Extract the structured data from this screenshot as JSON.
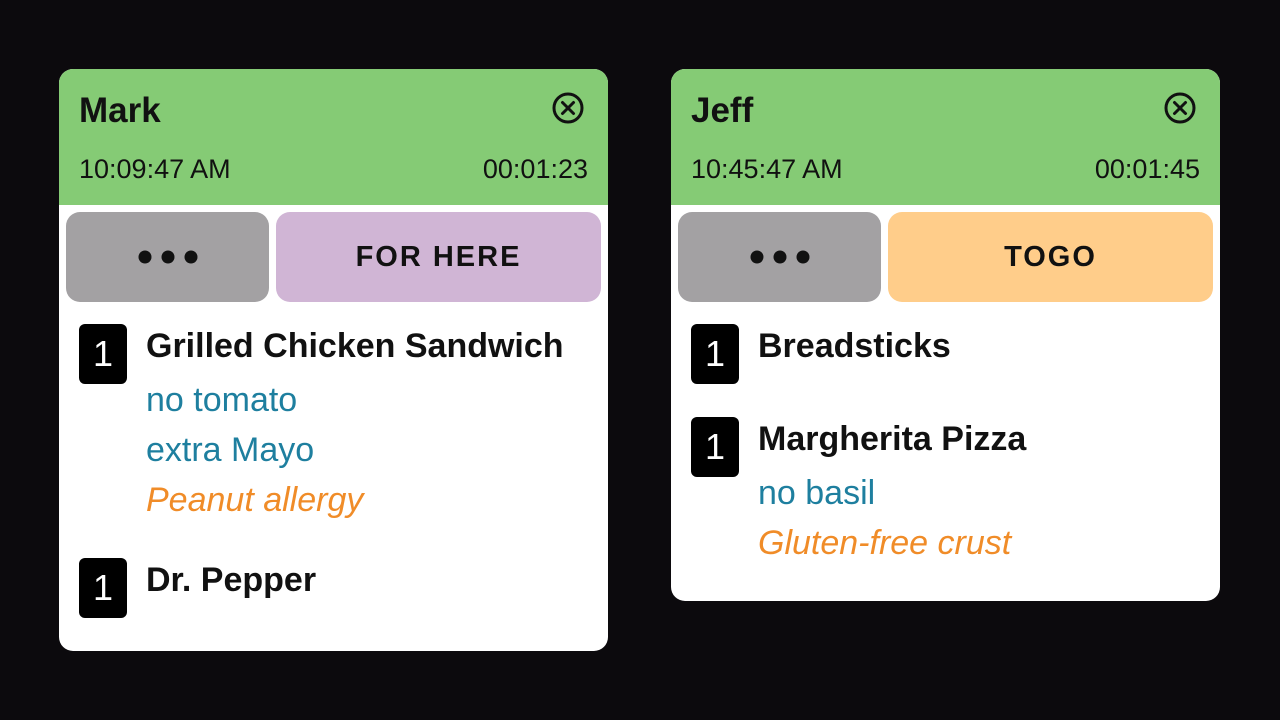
{
  "tickets": [
    {
      "customer": "Mark",
      "order_time": "10:09:47 AM",
      "elapsed": "00:01:23",
      "more_label": "•••",
      "order_type": "FOR HERE",
      "order_type_color": "#d0b5d5",
      "items": [
        {
          "qty": "1",
          "name": "Grilled Chicken Sandwich",
          "modifiers": [
            {
              "text": "no tomato",
              "kind": "change"
            },
            {
              "text": "extra Mayo",
              "kind": "change"
            },
            {
              "text": "Peanut allergy",
              "kind": "note"
            }
          ]
        },
        {
          "qty": "1",
          "name": "Dr. Pepper",
          "modifiers": []
        }
      ]
    },
    {
      "customer": "Jeff",
      "order_time": "10:45:47 AM",
      "elapsed": "00:01:45",
      "more_label": "•••",
      "order_type": "TOGO",
      "order_type_color": "#ffcd8a",
      "items": [
        {
          "qty": "1",
          "name": "Breadsticks",
          "modifiers": []
        },
        {
          "qty": "1",
          "name": "Margherita Pizza",
          "modifiers": [
            {
              "text": "no basil",
              "kind": "change"
            },
            {
              "text": "Gluten-free crust",
              "kind": "note"
            }
          ]
        }
      ]
    }
  ],
  "colors": {
    "header_green": "#85cb75",
    "modifier_change": "#1e7f9f",
    "modifier_note": "#f08c28",
    "more_button": "#a3a1a3"
  },
  "icons": {
    "close": "close-circle-icon",
    "more": "more-dots-icon"
  }
}
